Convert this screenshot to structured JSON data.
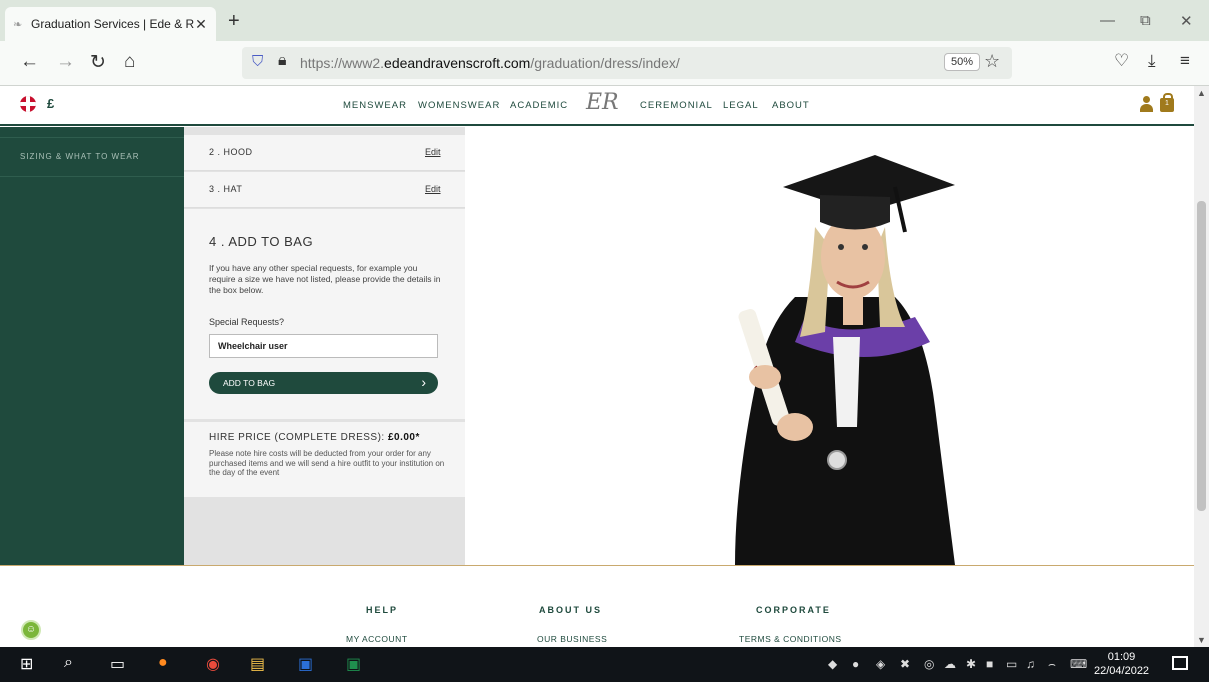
{
  "browser": {
    "tab_title": "Graduation Services | Ede & Rav",
    "url_prefix": "https://www2.",
    "url_domain": "edeandravenscroft.com",
    "url_path": "/graduation/dress/index/",
    "zoom": "50%"
  },
  "site": {
    "currency": "£",
    "menu": [
      "MENSWEAR",
      "WOMENSWEAR",
      "ACADEMIC",
      "CEREMONIAL",
      "LEGAL",
      "ABOUT"
    ],
    "logo": "ER",
    "bag_count": "1"
  },
  "sidebar": {
    "item": "SIZING & WHAT TO WEAR"
  },
  "steps": [
    {
      "label": "2 . HOOD",
      "edit": "Edit"
    },
    {
      "label": "3 . HAT",
      "edit": "Edit"
    }
  ],
  "add_to_bag": {
    "title": "4 . ADD TO BAG",
    "description": "If you have any other special requests, for example you require a size we have not listed, please provide the details in the box below.",
    "requests_label": "Special Requests?",
    "requests_value": "Wheelchair user",
    "button": "ADD TO BAG"
  },
  "price": {
    "title": "HIRE PRICE (COMPLETE DRESS): ",
    "amount": "£0.00*",
    "note": "Please note hire costs will be deducted from your order for any purchased items and we will send a hire outfit to your institution on the day of the event"
  },
  "footer": {
    "cols": [
      {
        "heading": "HELP",
        "link": "MY ACCOUNT"
      },
      {
        "heading": "ABOUT US",
        "link": "OUR BUSINESS"
      },
      {
        "heading": "CORPORATE",
        "link": "TERMS & CONDITIONS"
      }
    ]
  },
  "taskbar": {
    "time": "01:09",
    "date": "22/04/2022"
  },
  "colors": {
    "brand_green": "#1f4a3d",
    "gold": "#a07a1c"
  }
}
